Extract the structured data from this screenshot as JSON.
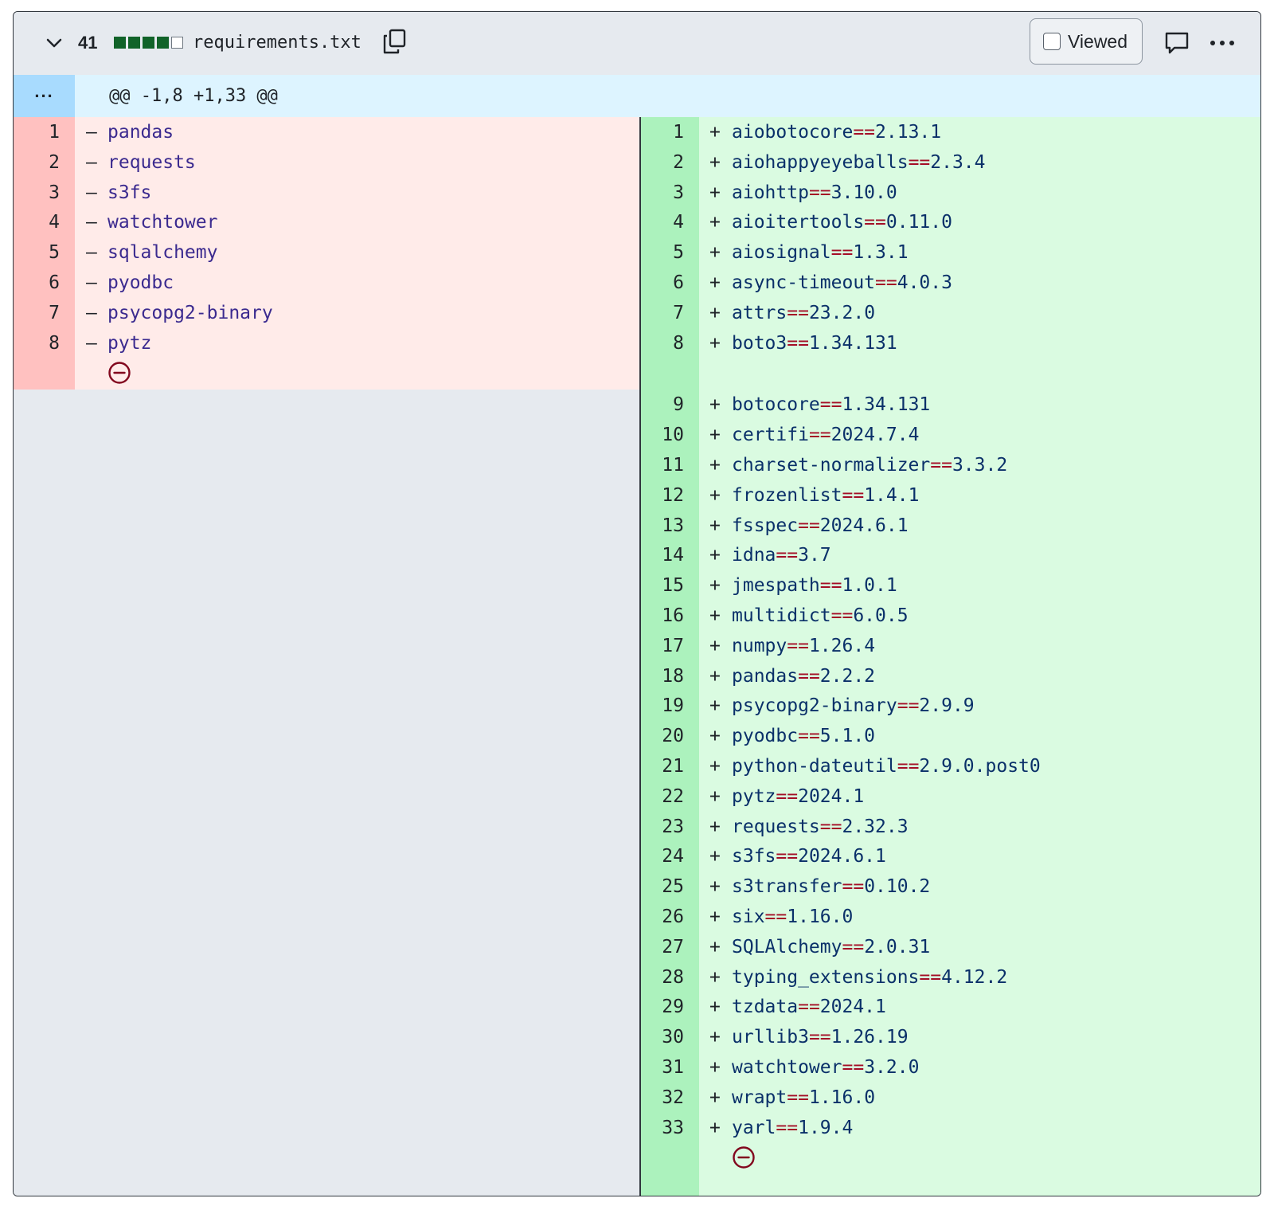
{
  "file": {
    "changed_lines": "41",
    "diffstat_blocks": [
      "added",
      "added",
      "added",
      "added",
      "neutral"
    ],
    "filename": "requirements.txt",
    "viewed_label": "Viewed",
    "viewed_checked": false
  },
  "hunk": {
    "expand_label": "...",
    "header": "@@ -1,8 +1,33 @@"
  },
  "left": {
    "rows": [
      {
        "num": "1",
        "sign": "–",
        "text": "pandas"
      },
      {
        "num": "2",
        "sign": "–",
        "text": "requests"
      },
      {
        "num": "3",
        "sign": "–",
        "text": "s3fs"
      },
      {
        "num": "4",
        "sign": "–",
        "text": "watchtower"
      },
      {
        "num": "5",
        "sign": "–",
        "text": "sqlalchemy"
      },
      {
        "num": "6",
        "sign": "–",
        "text": "pyodbc"
      },
      {
        "num": "7",
        "sign": "–",
        "text": "psycopg2-binary"
      },
      {
        "num": "8",
        "sign": "–",
        "text": "pytz"
      }
    ],
    "no_newline_icon": "no-entry-icon"
  },
  "right": {
    "rows": [
      {
        "num": "1",
        "name": "aiobotocore",
        "op": "==",
        "ver": "2.13.1"
      },
      {
        "num": "2",
        "name": "aiohappyeyeballs",
        "op": "==",
        "ver": "2.3.4"
      },
      {
        "num": "3",
        "name": "aiohttp",
        "op": "==",
        "ver": "3.10.0"
      },
      {
        "num": "4",
        "name": "aioitertools",
        "op": "==",
        "ver": "0.11.0"
      },
      {
        "num": "5",
        "name": "aiosignal",
        "op": "==",
        "ver": "1.3.1"
      },
      {
        "num": "6",
        "name": "async-timeout",
        "op": "==",
        "ver": "4.0.3"
      },
      {
        "num": "7",
        "name": "attrs",
        "op": "==",
        "ver": "23.2.0"
      },
      {
        "num": "8",
        "name": "boto3",
        "op": "==",
        "ver": "1.34.131"
      },
      {
        "num": "9",
        "name": "botocore",
        "op": "==",
        "ver": "1.34.131"
      },
      {
        "num": "10",
        "name": "certifi",
        "op": "==",
        "ver": "2024.7.4"
      },
      {
        "num": "11",
        "name": "charset-normalizer",
        "op": "==",
        "ver": "3.3.2"
      },
      {
        "num": "12",
        "name": "frozenlist",
        "op": "==",
        "ver": "1.4.1"
      },
      {
        "num": "13",
        "name": "fsspec",
        "op": "==",
        "ver": "2024.6.1"
      },
      {
        "num": "14",
        "name": "idna",
        "op": "==",
        "ver": "3.7"
      },
      {
        "num": "15",
        "name": "jmespath",
        "op": "==",
        "ver": "1.0.1"
      },
      {
        "num": "16",
        "name": "multidict",
        "op": "==",
        "ver": "6.0.5"
      },
      {
        "num": "17",
        "name": "numpy",
        "op": "==",
        "ver": "1.26.4"
      },
      {
        "num": "18",
        "name": "pandas",
        "op": "==",
        "ver": "2.2.2"
      },
      {
        "num": "19",
        "name": "psycopg2-binary",
        "op": "==",
        "ver": "2.9.9"
      },
      {
        "num": "20",
        "name": "pyodbc",
        "op": "==",
        "ver": "5.1.0"
      },
      {
        "num": "21",
        "name": "python-dateutil",
        "op": "==",
        "ver": "2.9.0.post0"
      },
      {
        "num": "22",
        "name": "pytz",
        "op": "==",
        "ver": "2024.1"
      },
      {
        "num": "23",
        "name": "requests",
        "op": "==",
        "ver": "2.32.3"
      },
      {
        "num": "24",
        "name": "s3fs",
        "op": "==",
        "ver": "2024.6.1"
      },
      {
        "num": "25",
        "name": "s3transfer",
        "op": "==",
        "ver": "0.10.2"
      },
      {
        "num": "26",
        "name": "six",
        "op": "==",
        "ver": "1.16.0"
      },
      {
        "num": "27",
        "name": "SQLAlchemy",
        "op": "==",
        "ver": "2.0.31"
      },
      {
        "num": "28",
        "name": "typing_extensions",
        "op": "==",
        "ver": "4.12.2"
      },
      {
        "num": "29",
        "name": "tzdata",
        "op": "==",
        "ver": "2024.1"
      },
      {
        "num": "30",
        "name": "urllib3",
        "op": "==",
        "ver": "1.26.19"
      },
      {
        "num": "31",
        "name": "watchtower",
        "op": "==",
        "ver": "3.2.0"
      },
      {
        "num": "32",
        "name": "wrapt",
        "op": "==",
        "ver": "1.16.0"
      },
      {
        "num": "33",
        "name": "yarl",
        "op": "==",
        "ver": "1.9.4"
      }
    ],
    "sign": "+",
    "no_newline_icon": "no-entry-icon"
  },
  "colors": {
    "deleted_gutter": "#ffc1c0",
    "deleted_bg": "#ffebe9",
    "added_gutter": "#acf2bd",
    "added_bg": "#dafbe1",
    "hunk_bg": "#ddf4ff",
    "hunk_expand_bg": "#a8dbfe",
    "no_newline_icon": "#82071e"
  }
}
